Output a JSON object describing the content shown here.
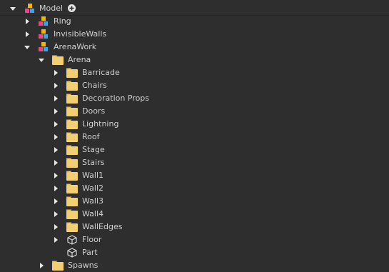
{
  "explorer": {
    "root": {
      "label": "Model",
      "add_icon": "add-circle-icon",
      "expanded": true
    },
    "items": [
      {
        "label": "Ring",
        "icon": "model-icon",
        "expanded": false
      },
      {
        "label": "InvisibleWalls",
        "icon": "model-icon",
        "expanded": false
      },
      {
        "label": "ArenaWork",
        "icon": "model-icon",
        "expanded": true
      },
      {
        "label": "Arena",
        "icon": "folder-icon",
        "expanded": true
      },
      {
        "label": "Barricade",
        "icon": "folder-icon",
        "expanded": false
      },
      {
        "label": "Chairs",
        "icon": "folder-icon",
        "expanded": false
      },
      {
        "label": "Decoration Props",
        "icon": "folder-icon",
        "expanded": false
      },
      {
        "label": "Doors",
        "icon": "folder-icon",
        "expanded": false
      },
      {
        "label": "Lightning",
        "icon": "folder-icon",
        "expanded": false
      },
      {
        "label": "Roof",
        "icon": "folder-icon",
        "expanded": false
      },
      {
        "label": "Stage",
        "icon": "folder-icon",
        "expanded": false
      },
      {
        "label": "Stairs",
        "icon": "folder-icon",
        "expanded": false
      },
      {
        "label": "Wall1",
        "icon": "folder-icon",
        "expanded": false
      },
      {
        "label": "Wall2",
        "icon": "folder-icon",
        "expanded": false
      },
      {
        "label": "Wall3",
        "icon": "folder-icon",
        "expanded": false
      },
      {
        "label": "Wall4",
        "icon": "folder-icon",
        "expanded": false
      },
      {
        "label": "WallEdges",
        "icon": "folder-icon",
        "expanded": false
      },
      {
        "label": "Floor",
        "icon": "part-icon",
        "expanded": false
      },
      {
        "label": "Part",
        "icon": "part-icon",
        "expanded": null
      },
      {
        "label": "Spawns",
        "icon": "folder-icon",
        "expanded": false
      }
    ]
  },
  "colors": {
    "background": "#2e2e2e",
    "text": "#d0d0d0",
    "folder": "#f2cf73",
    "arrow": "#e6e6e6"
  }
}
